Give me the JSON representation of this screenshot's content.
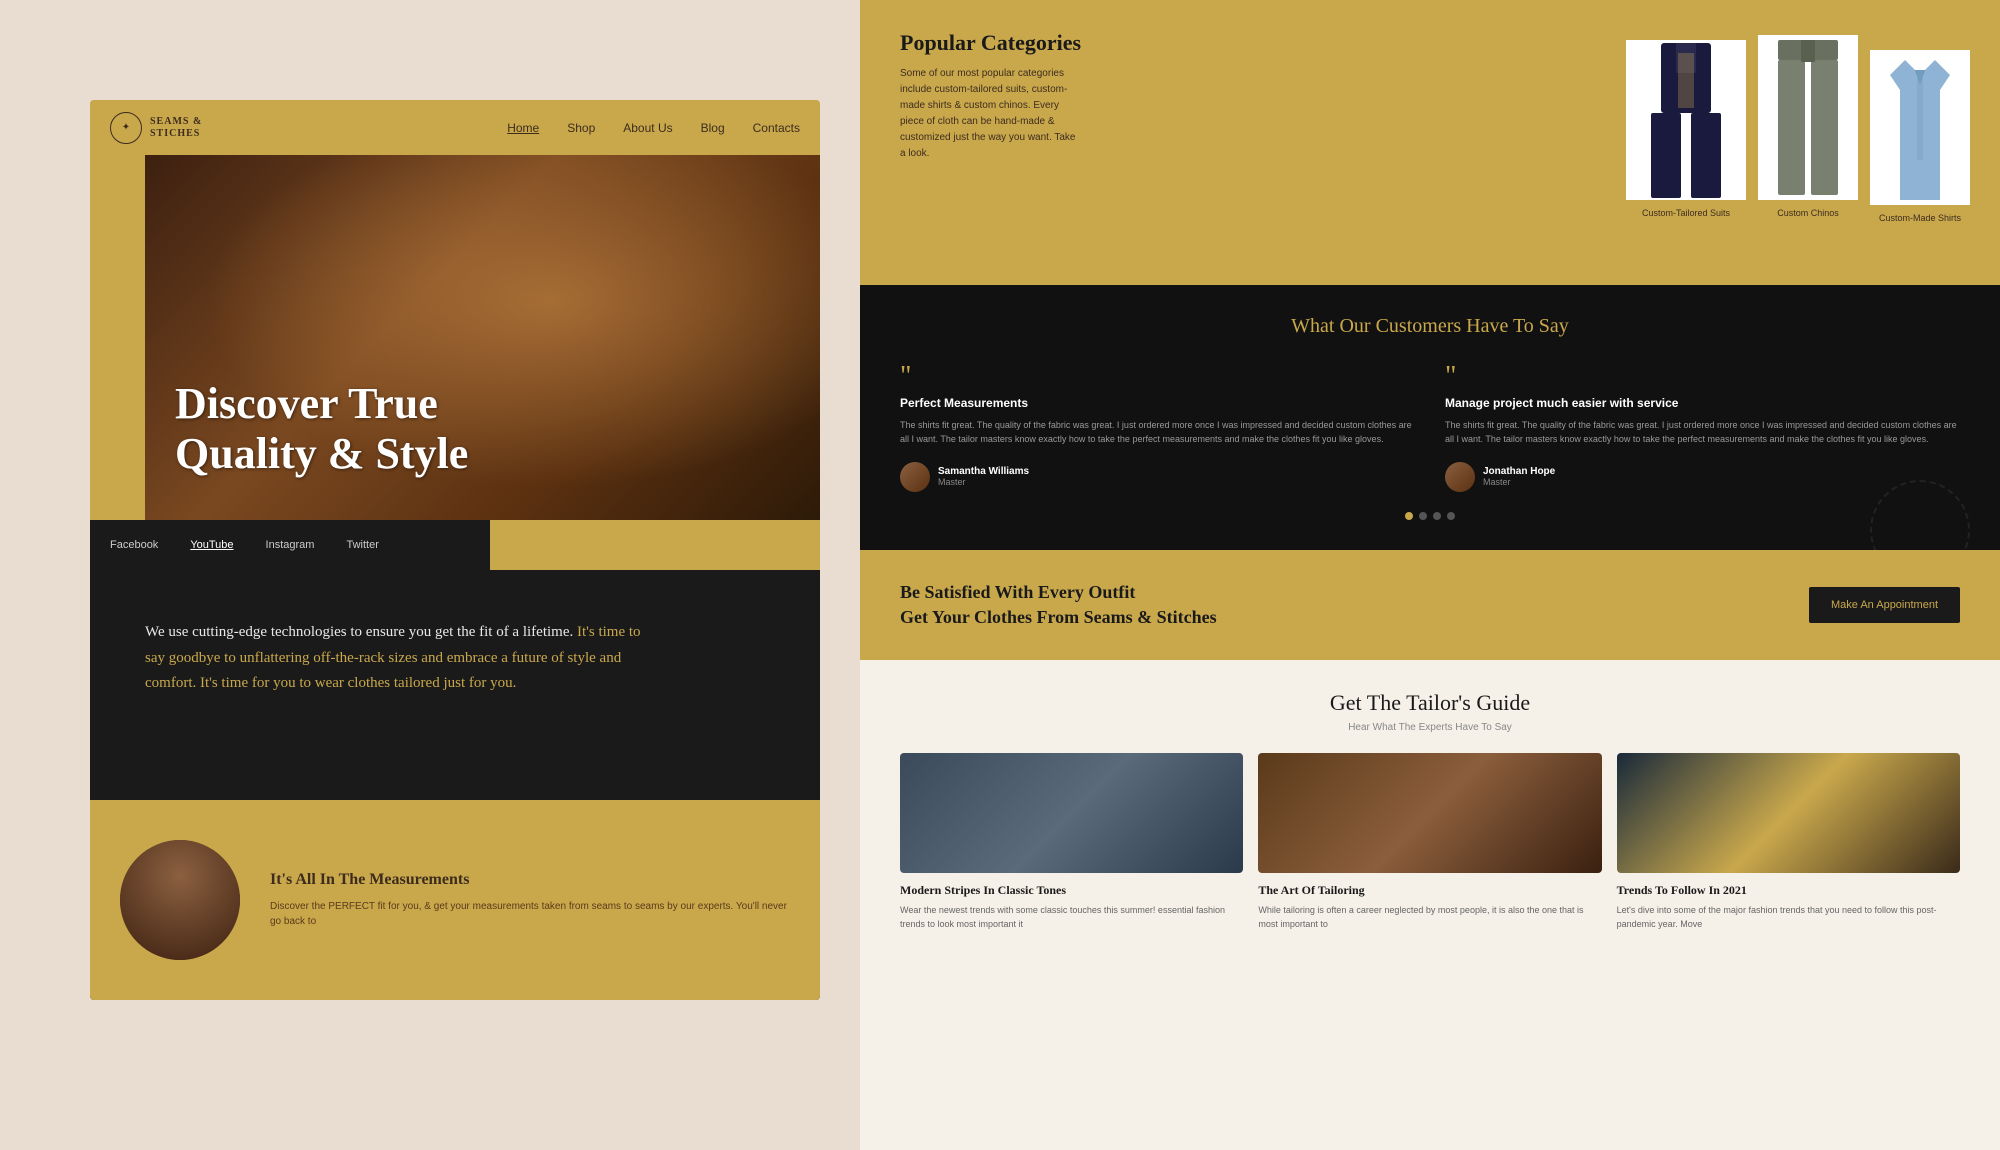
{
  "nav": {
    "logo_line1": "SEAMS &",
    "logo_line2": "STICHES",
    "links": [
      {
        "label": "Home",
        "active": true
      },
      {
        "label": "Shop",
        "active": false
      },
      {
        "label": "About Us",
        "active": false
      },
      {
        "label": "Blog",
        "active": false
      },
      {
        "label": "Contacts",
        "active": false
      }
    ]
  },
  "hero": {
    "title_line1": "Discover True",
    "title_line2": "Quality & Style"
  },
  "social": {
    "links": [
      {
        "label": "Facebook",
        "underline": false
      },
      {
        "label": "YouTube",
        "underline": true
      },
      {
        "label": "Instagram",
        "underline": false
      },
      {
        "label": "Twitter",
        "underline": false
      }
    ]
  },
  "body_text": {
    "main": "We use cutting-edge technologies to ensure you get the fit of a lifetime.",
    "highlighted": "It's time to say goodbye to unflattering off-the-rack sizes and embrace a future of style and comfort. It's time for you to wear clothes tailored just for you."
  },
  "measurements": {
    "title": "It's All In The Measurements",
    "body": "Discover the PERFECT fit for you, & get your measurements taken from seams to seams by our experts. You'll never go back to"
  },
  "popular_categories": {
    "title": "Popular Categories",
    "description": "Some of our most popular categories include custom-tailored suits, custom-made shirts & custom chinos. Every piece of cloth can be hand-made & customized just the way you want. Take a look.",
    "items": [
      {
        "label": "Custom-Tailored Suits"
      },
      {
        "label": "Custom Chinos"
      },
      {
        "label": "Custom-Made Shirts"
      }
    ]
  },
  "testimonials": {
    "title": "What Our Customers Have To Say",
    "items": [
      {
        "quote_mark": "““",
        "heading": "Perfect Measurements",
        "body": "The shirts fit great. The quality of the fabric was great. I just ordered more once I was impressed and decided custom clothes are all I want. The tailor masters know exactly how to take the perfect measurements and make the clothes fit you like gloves.",
        "reviewer_name": "Samantha Williams",
        "reviewer_role": "Master"
      },
      {
        "quote_mark": "““",
        "heading": "Manage project much easier with service",
        "body": "The shirts fit great. The quality of the fabric was great. I just ordered more once I was impressed and decided custom clothes are all I want. The tailor masters know exactly how to take the perfect measurements and make the clothes fit you like gloves.",
        "reviewer_name": "Jonathan Hope",
        "reviewer_role": "Master"
      }
    ],
    "dots": [
      true,
      false,
      false,
      false
    ]
  },
  "cta": {
    "title_line1": "Be Satisfied With Every Outfit",
    "title_line2": "Get Your Clothes From Seams & Stitches",
    "button_label": "Make An Appointment"
  },
  "blog": {
    "title": "Get The Tailor's Guide",
    "subtitle": "Hear What The Experts Have To Say",
    "posts": [
      {
        "title": "Modern Stripes In Classic Tones",
        "body": "Wear the newest trends with some classic touches this summer! essential fashion trends to look most important it"
      },
      {
        "title": "The Art Of Tailoring",
        "body": "While tailoring is often a career neglected by most people, it is also the one that is most important to"
      },
      {
        "title": "Trends To Follow In 2021",
        "body": "Let's dive into some of the major fashion trends that you need to follow this post-pandemic year. Move"
      }
    ]
  },
  "colors": {
    "gold": "#c9a84c",
    "dark": "#1a1a1a",
    "bg": "#e8ddd0"
  }
}
